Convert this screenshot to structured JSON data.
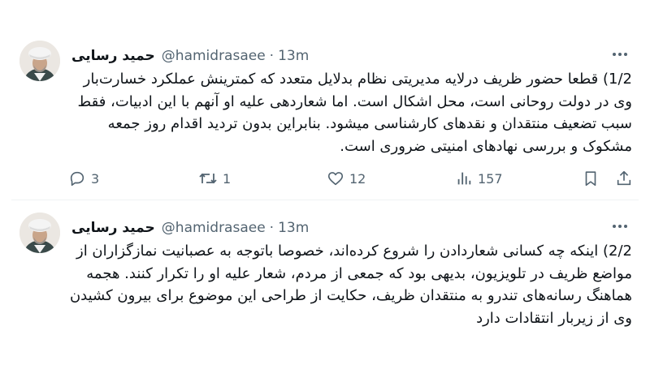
{
  "tweets": [
    {
      "author": {
        "name": "حمید رسایی",
        "handle": "@hamidrasaee",
        "time": "13m"
      },
      "text": "1/2) قطعا حضور ظریف درلایه مدیریتی نظام بدلایل متعدد که کمترینش عملکرد خسارت‌بار وی در دولت روحانی است، محل اشکال است. اما شعاردهی علیه او آنهم با این ادبیات، فقط سبب تضعیف منتقدان و نقدهای کارشناسی میشود. بنابراین بدون تردید اقدام روز جمعه مشکوک و بررسی نهادهای امنیتی ضروری است.",
      "stats": {
        "replies": "3",
        "reposts": "1",
        "likes": "12",
        "views": "157"
      }
    },
    {
      "author": {
        "name": "حمید رسایی",
        "handle": "@hamidrasaee",
        "time": "13m"
      },
      "text": "2/2) اینکه چه کسانی شعاردادن را شروع کرده‌اند، خصوصا باتوجه به عصبانیت نمازگزاران از مواضع ظریف در تلویزیون، بدیهی بود که جمعی از مردم، شعار علیه او را تکرار کنند. هجمه هماهنگ رسانه‌های تندرو به منتقدان ظریف، حکایت از طراحی این موضوع برای بیرون کشیدن وی از زیربار انتقادات دارد"
    }
  ],
  "icons": {
    "more": "more-horizontal-icon",
    "reply": "reply-icon",
    "repost": "repost-icon",
    "like": "heart-icon",
    "views": "analytics-icon",
    "bookmark": "bookmark-icon",
    "share": "share-icon"
  },
  "colors": {
    "text": "#0f1419",
    "secondary": "#536471",
    "divider": "#eff3f4",
    "background": "#ffffff"
  }
}
